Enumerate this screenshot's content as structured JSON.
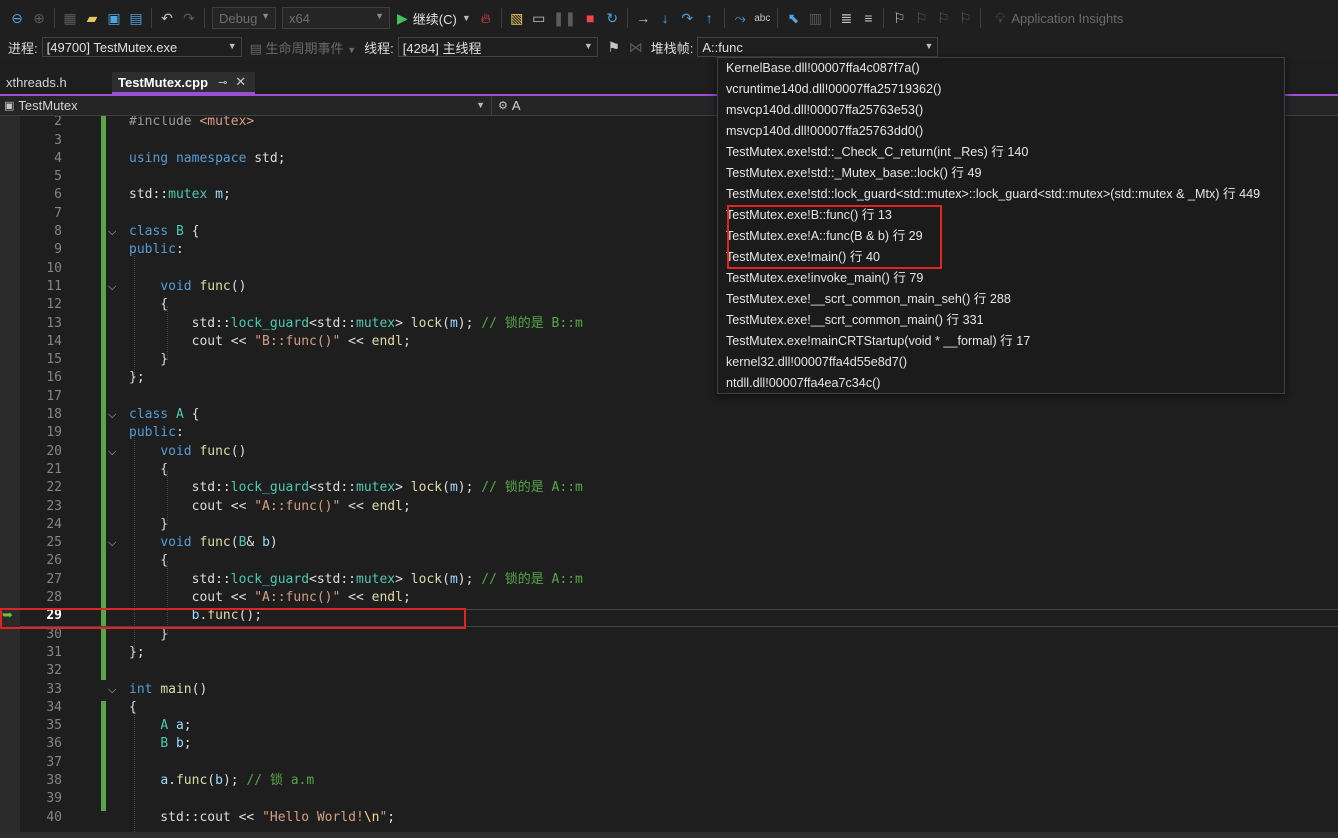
{
  "toolbar": {
    "config": "Debug",
    "platform": "x64",
    "continue_label": "继续(C)",
    "insights_label": "Application Insights"
  },
  "debugbar": {
    "process_label": "进程:",
    "process_value": "[49700] TestMutex.exe",
    "lifecycle_label": "生命周期事件",
    "thread_label": "线程:",
    "thread_value": "[4284] 主线程",
    "stackframe_label": "堆栈帧:",
    "stackframe_value": "A::func"
  },
  "tabs": [
    {
      "label": "xthreads.h",
      "active": false
    },
    {
      "label": "TestMutex.cpp",
      "active": true
    }
  ],
  "navbar": {
    "scope": "TestMutex",
    "member": "A"
  },
  "editor": {
    "current_line": 29,
    "lines": [
      {
        "n": "2"
      },
      {
        "n": "3"
      },
      {
        "n": "4"
      },
      {
        "n": "5"
      },
      {
        "n": "6"
      },
      {
        "n": "7"
      },
      {
        "n": "8"
      },
      {
        "n": "9"
      },
      {
        "n": "10"
      },
      {
        "n": "11"
      },
      {
        "n": "12"
      },
      {
        "n": "13"
      },
      {
        "n": "14"
      },
      {
        "n": "15"
      },
      {
        "n": "16"
      },
      {
        "n": "17"
      },
      {
        "n": "18"
      },
      {
        "n": "19"
      },
      {
        "n": "20"
      },
      {
        "n": "21"
      },
      {
        "n": "22"
      },
      {
        "n": "23"
      },
      {
        "n": "24"
      },
      {
        "n": "25"
      },
      {
        "n": "26"
      },
      {
        "n": "27"
      },
      {
        "n": "28"
      },
      {
        "n": "29"
      },
      {
        "n": "30"
      },
      {
        "n": "31"
      },
      {
        "n": "32"
      },
      {
        "n": "33"
      },
      {
        "n": "34"
      },
      {
        "n": "35"
      },
      {
        "n": "36"
      },
      {
        "n": "37"
      },
      {
        "n": "38"
      },
      {
        "n": "39"
      },
      {
        "n": "40"
      }
    ]
  },
  "call_stack": [
    "KernelBase.dll!00007ffa4c087f7a()",
    "vcruntime140d.dll!00007ffa25719362()",
    "msvcp140d.dll!00007ffa25763e53()",
    "msvcp140d.dll!00007ffa25763dd0()",
    "TestMutex.exe!std::_Check_C_return(int _Res) 行 140",
    "TestMutex.exe!std::_Mutex_base::lock() 行 49",
    "TestMutex.exe!std::lock_guard<std::mutex>::lock_guard<std::mutex>(std::mutex & _Mtx) 行 449",
    "TestMutex.exe!B::func() 行 13",
    "TestMutex.exe!A::func(B & b) 行 29",
    "TestMutex.exe!main() 行 40",
    "TestMutex.exe!invoke_main() 行 79",
    "TestMutex.exe!__scrt_common_main_seh() 行 288",
    "TestMutex.exe!__scrt_common_main() 行 331",
    "TestMutex.exe!mainCRTStartup(void * __formal) 行 17",
    "kernel32.dll!00007ffa4d55e8d7()",
    "ntdll.dll!00007ffa4ea7c34c()"
  ],
  "colors": {
    "accent": "#9b4fd4",
    "highlight": "#e02424",
    "change_bar": "#57a64a"
  }
}
